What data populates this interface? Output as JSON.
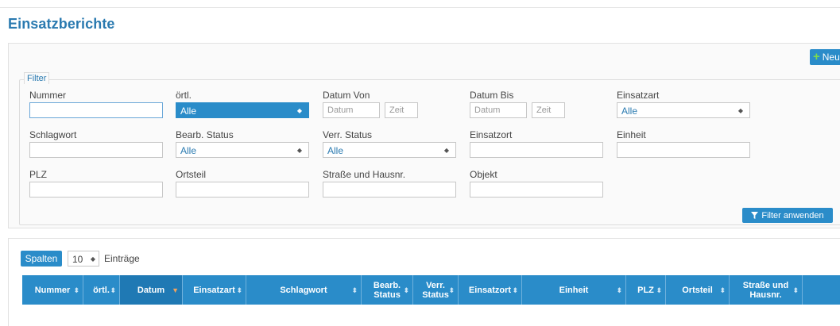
{
  "page": {
    "title": "Einsatzberichte"
  },
  "toolbar": {
    "new_label": "Neu"
  },
  "filter": {
    "legend": "Filter",
    "fields": {
      "nummer": {
        "label": "Nummer",
        "value": ""
      },
      "oertl": {
        "label": "örtl.",
        "value": "Alle"
      },
      "datum_von": {
        "label": "Datum Von",
        "date_placeholder": "Datum",
        "time_placeholder": "Zeit"
      },
      "datum_bis": {
        "label": "Datum Bis",
        "date_placeholder": "Datum",
        "time_placeholder": "Zeit"
      },
      "einsatzart": {
        "label": "Einsatzart",
        "value": "Alle"
      },
      "schlagwort": {
        "label": "Schlagwort",
        "value": ""
      },
      "bearb_status": {
        "label": "Bearb. Status",
        "value": "Alle"
      },
      "verr_status": {
        "label": "Verr. Status",
        "value": "Alle"
      },
      "einsatzort": {
        "label": "Einsatzort",
        "value": ""
      },
      "einheit": {
        "label": "Einheit",
        "value": ""
      },
      "plz": {
        "label": "PLZ",
        "value": ""
      },
      "ortsteil": {
        "label": "Ortsteil",
        "value": ""
      },
      "strasse": {
        "label": "Straße und Hausnr.",
        "value": ""
      },
      "objekt": {
        "label": "Objekt",
        "value": ""
      }
    },
    "apply_label": "Filter anwenden"
  },
  "table": {
    "columns_button": "Spalten",
    "page_length": "10",
    "entries_label": "Einträge",
    "headers": [
      {
        "line1": "Nummer",
        "line2": ""
      },
      {
        "line1": "örtl.",
        "line2": ""
      },
      {
        "line1": "Datum",
        "line2": ""
      },
      {
        "line1": "Einsatzart",
        "line2": ""
      },
      {
        "line1": "Schlagwort",
        "line2": ""
      },
      {
        "line1": "Bearb.",
        "line2": "Status"
      },
      {
        "line1": "Verr.",
        "line2": "Status"
      },
      {
        "line1": "Einsatzort",
        "line2": ""
      },
      {
        "line1": "Einheit",
        "line2": ""
      },
      {
        "line1": "PLZ",
        "line2": ""
      },
      {
        "line1": "Ortsteil",
        "line2": ""
      },
      {
        "line1": "Straße und",
        "line2": "Hausnr."
      }
    ],
    "sorted_column": "Datum"
  },
  "colors": {
    "accent": "#2a8cc9",
    "title": "#2a7ab0",
    "sort_active": "#f0a35e"
  },
  "icons": {
    "new": "plus-icon",
    "apply": "filter-funnel-icon",
    "sort": "sort-both-icon"
  }
}
